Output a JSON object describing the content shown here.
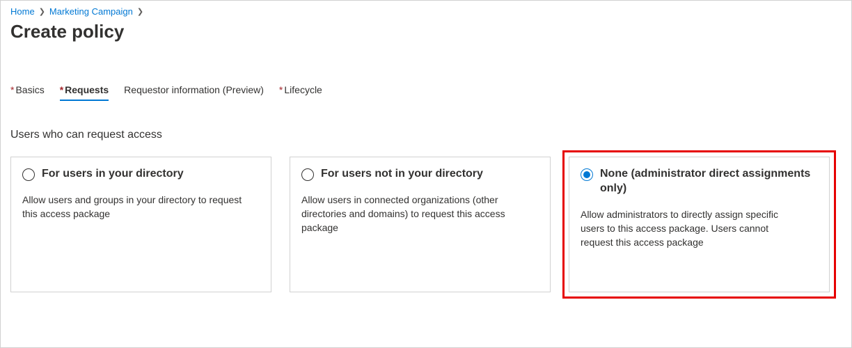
{
  "breadcrumb": {
    "items": [
      "Home",
      "Marketing Campaign"
    ]
  },
  "page_title": "Create policy",
  "tabs": [
    {
      "label": "Basics",
      "required": true,
      "active": false
    },
    {
      "label": "Requests",
      "required": true,
      "active": true
    },
    {
      "label": "Requestor information (Preview)",
      "required": false,
      "active": false
    },
    {
      "label": "Lifecycle",
      "required": true,
      "active": false
    }
  ],
  "section": {
    "heading": "Users who can request access",
    "options": [
      {
        "title": "For users in your directory",
        "description": "Allow users and groups in your directory to request this access package",
        "selected": false,
        "highlighted": false
      },
      {
        "title": "For users not in your directory",
        "description": "Allow users in connected organizations (other directories and domains) to request this access package",
        "selected": false,
        "highlighted": false
      },
      {
        "title": "None (administrator direct assignments only)",
        "description": "Allow administrators to directly assign specific users to this access package. Users cannot request this access package",
        "selected": true,
        "highlighted": true
      }
    ]
  }
}
